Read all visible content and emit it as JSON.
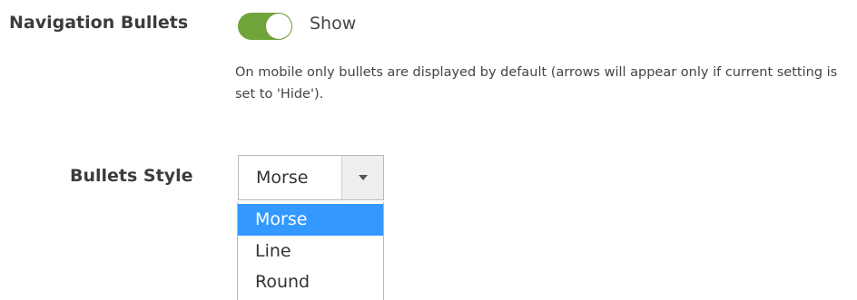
{
  "navigation_bullets": {
    "label": "Navigation Bullets",
    "toggle_state": "on",
    "toggle_text": "Show",
    "toggle_color": "#6fa43a",
    "help_text": "On mobile only bullets are displayed by default (arrows will appear only if current setting is set to 'Hide')."
  },
  "bullets_style": {
    "label": "Bullets Style",
    "selected_value": "Morse",
    "options": [
      {
        "label": "Morse",
        "highlighted": true
      },
      {
        "label": "Line",
        "highlighted": false
      },
      {
        "label": "Round",
        "highlighted": false
      }
    ],
    "highlight_color": "#3399ff"
  }
}
